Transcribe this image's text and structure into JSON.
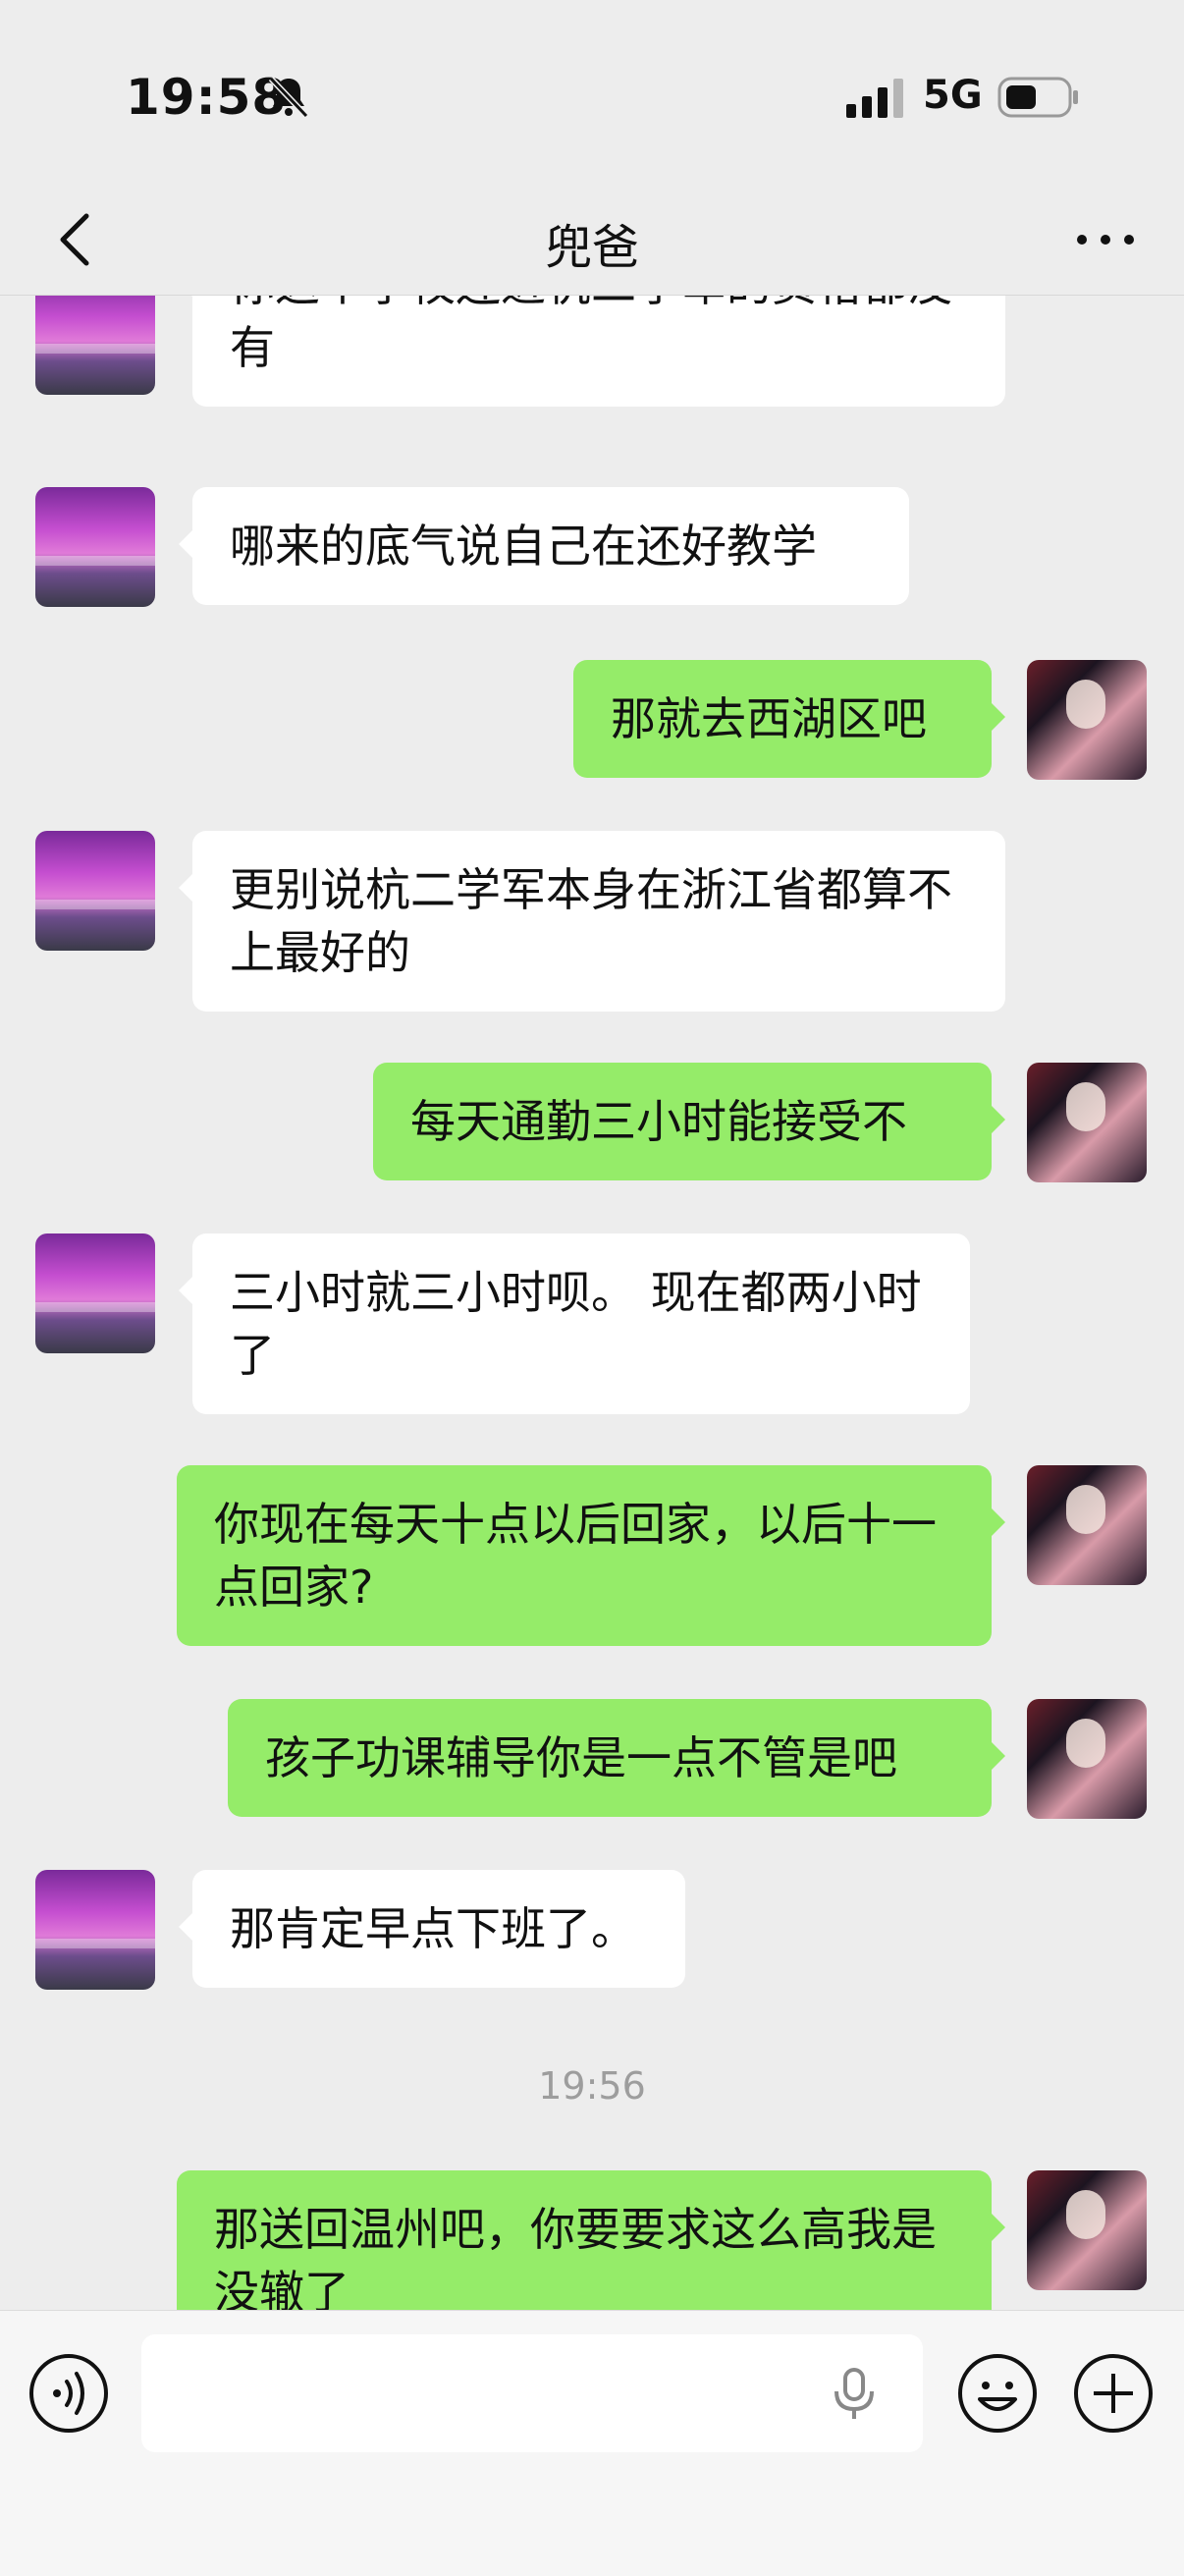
{
  "status_bar": {
    "time": "19:58",
    "network": "5G"
  },
  "header": {
    "title": "兜爸"
  },
  "messages": [
    {
      "side": "left",
      "text": "你这个学校连进杭二学军的资格都没有"
    },
    {
      "side": "left",
      "text": "哪来的底气说自己在还好教学"
    },
    {
      "side": "right",
      "text": "那就去西湖区吧"
    },
    {
      "side": "left",
      "text": "更别说杭二学军本身在浙江省都算不上最好的"
    },
    {
      "side": "right",
      "text": "每天通勤三小时能接受不"
    },
    {
      "side": "left",
      "text": "三小时就三小时呗。 现在都两小时了"
    },
    {
      "side": "right",
      "text": "你现在每天十点以后回家，以后十一点回家?"
    },
    {
      "side": "right",
      "text": "孩子功课辅导你是一点不管是吧"
    },
    {
      "side": "left",
      "text": "那肯定早点下班了。"
    },
    {
      "side": "right",
      "text": "那送回温州吧，你要要求这么高我是没辙了"
    }
  ],
  "timestamp": "19:56",
  "input": {
    "placeholder": ""
  },
  "colors": {
    "bubble_self": "#95ec69",
    "bubble_other": "#ffffff",
    "background": "#ededed"
  }
}
